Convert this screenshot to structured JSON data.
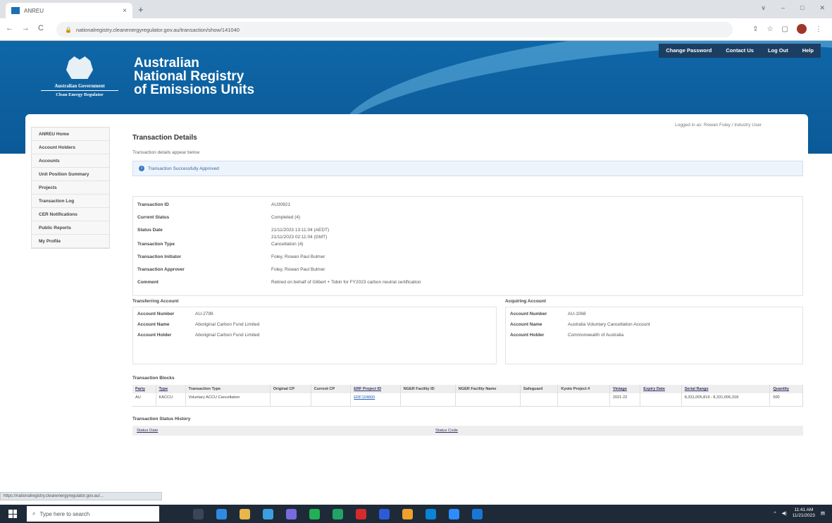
{
  "browser": {
    "tab_title": "ANREU",
    "tab_close": "×",
    "new_tab": "+",
    "url": "nationalregistry.cleanenergyregulator.gov.au/transaction/show/141040",
    "window_controls": [
      "∨",
      "–",
      "□",
      "✕"
    ]
  },
  "header": {
    "gov_line1": "Australian Government",
    "gov_line2": "Clean Energy Regulator",
    "title_line1": "Australian",
    "title_line2": "National Registry",
    "title_line3": "of Emissions Units",
    "nav": [
      "Change Password",
      "Contact Us",
      "Log Out",
      "Help"
    ]
  },
  "logged_in": "Logged in as: Rowan Foley / Industry User",
  "sidebar": {
    "items": [
      "ANREU Home",
      "Account Holders",
      "Accounts",
      "Unit Position Summary",
      "Projects",
      "Transaction Log",
      "CER Notifications",
      "Public Reports",
      "My Profile"
    ]
  },
  "page": {
    "title": "Transaction Details",
    "subtitle": "Transaction details appear below",
    "success_message": "Transaction Successfully Approved"
  },
  "details": [
    {
      "label": "Transaction ID",
      "value": "AU30821"
    },
    {
      "label": "Current Status",
      "value": "Completed (4)"
    },
    {
      "label": "Status Date",
      "value": "21/11/2023 13:11:04 (AEDT)",
      "value2": "21/11/2023 02:11:04 (GMT)"
    },
    {
      "label": "Transaction Type",
      "value": "Cancellation (4)"
    },
    {
      "label": "Transaction Initiator",
      "value": "Foley, Rowan Paul Bulmer"
    },
    {
      "label": "Transaction Approver",
      "value": "Foley, Rowan Paul Bulmer"
    },
    {
      "label": "Comment",
      "value": "Retired on behalf of Gilbert + Tobin for FY2023 carbon neutral certification"
    }
  ],
  "transferring": {
    "heading": "Transferring Account",
    "rows": [
      {
        "label": "Account Number",
        "value": "AU-2798"
      },
      {
        "label": "Account Name",
        "value": "Aboriginal Carbon Fund Limited"
      },
      {
        "label": "Account Holder",
        "value": "Aboriginal Carbon Fund Limited"
      }
    ]
  },
  "acquiring": {
    "heading": "Acquiring Account",
    "rows": [
      {
        "label": "Account Number",
        "value": "AU-1068"
      },
      {
        "label": "Account Name",
        "value": "Australia Voluntary Cancellation Account"
      },
      {
        "label": "Account Holder",
        "value": "Commonwealth of Australia"
      }
    ]
  },
  "blocks": {
    "title": "Transaction Blocks",
    "columns": [
      "Party",
      "Type",
      "Transaction Type",
      "Original CP",
      "Current CP",
      "ERF Project ID",
      "NGER Facility ID",
      "NGER Facility Name",
      "Safeguard",
      "Kyoto Project #",
      "Vintage",
      "Expiry Date",
      "Serial Range",
      "Quantity"
    ],
    "rows": [
      [
        "AU",
        "KACCU",
        "Voluntary ACCU Cancellation",
        "",
        "",
        "ERF104800",
        "",
        "",
        "",
        "",
        "2021-22",
        "",
        "8,331,005,819 - 8,331,006,318",
        "500"
      ]
    ]
  },
  "history": {
    "title": "Transaction Status History",
    "col1": "Status Date",
    "col2": "Status Code"
  },
  "status_bar_url": "https://nationalregistry.cleanenergyregulator.gov.au/...",
  "taskbar": {
    "search_placeholder": "Type here to search",
    "time": "11:41 AM",
    "date": "11/21/2023"
  },
  "colors": {
    "banner": "#0d5f9d",
    "nav_bg": "#1d3e63",
    "link": "#1f5fb8"
  }
}
